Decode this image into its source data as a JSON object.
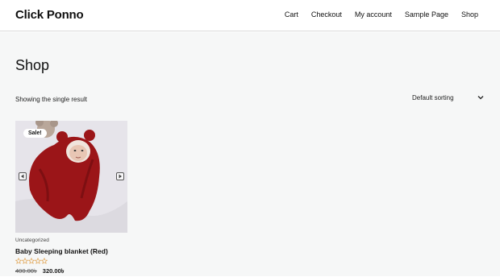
{
  "header": {
    "site_title": "Click Ponno",
    "nav": [
      "Cart",
      "Checkout",
      "My account",
      "Sample Page",
      "Shop"
    ]
  },
  "page": {
    "title": "Shop",
    "result_count": "Showing the single result",
    "sorting": {
      "selected": "Default sorting"
    }
  },
  "products": [
    {
      "badge": "Sale!",
      "category": "Uncategorized",
      "name": "Baby Sleeping blanket (Red)",
      "rating": 0,
      "max_rating": 5,
      "old_price": "400.00৳",
      "price": "320.00৳",
      "image_icon": "baby-in-red-blanket-photo"
    }
  ],
  "colors": {
    "star_outline": "#e0a04a",
    "blanket_red": "#9b1518"
  }
}
